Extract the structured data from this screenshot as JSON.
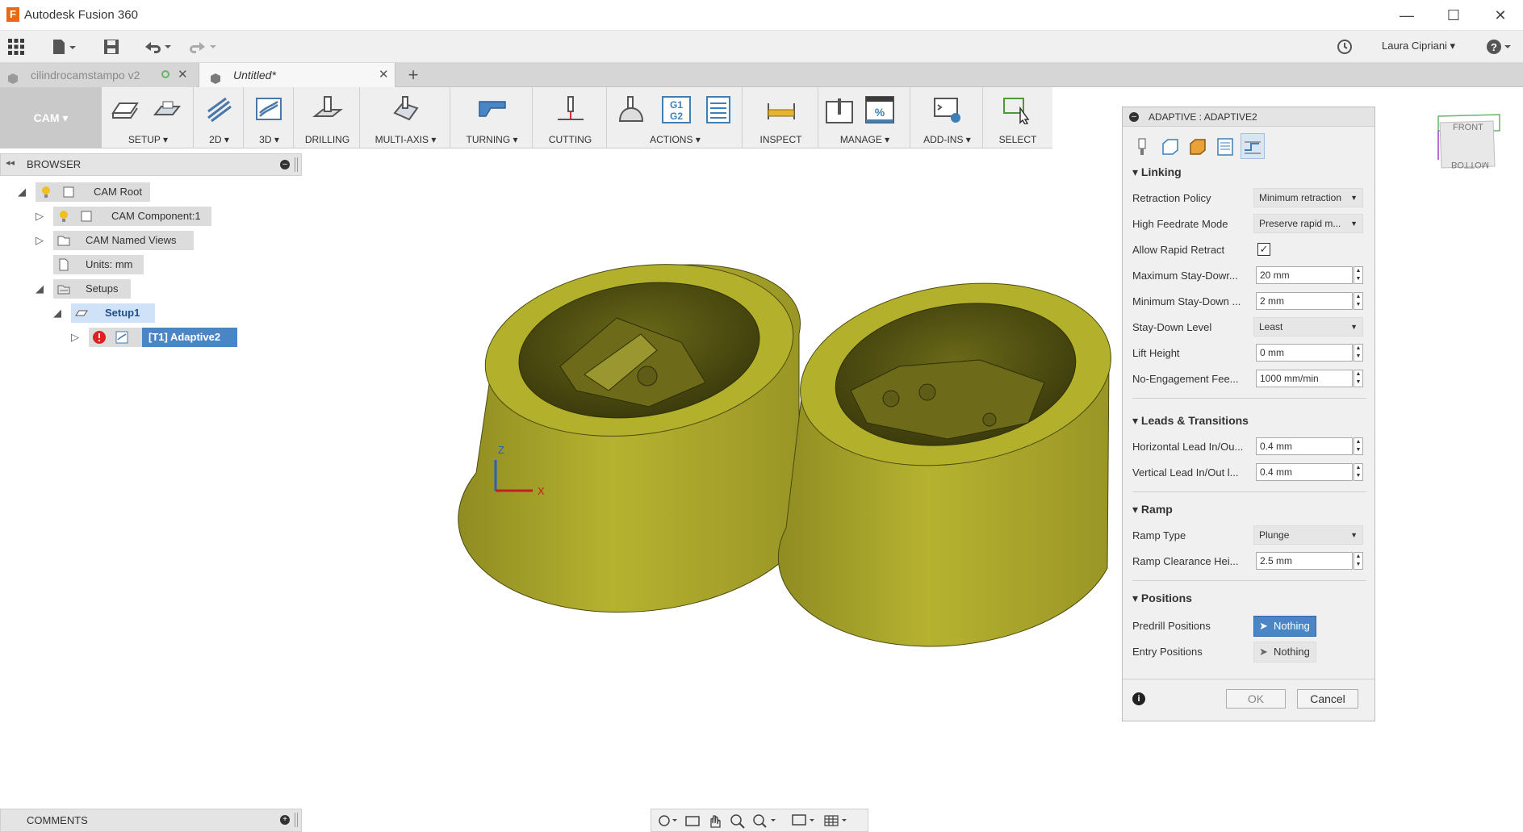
{
  "window": {
    "title": "Autodesk Fusion 360",
    "minimize": "—",
    "maximize": "☐",
    "close": "✕"
  },
  "user": {
    "name": "Laura Cipriani ▾"
  },
  "tabs": [
    {
      "label": "cilindrocamstampo v2",
      "active": false
    },
    {
      "label": "Untitled*",
      "active": true
    }
  ],
  "ribbon": {
    "workspace": "CAM ▾",
    "groups": [
      {
        "label": "SETUP ▾"
      },
      {
        "label": "2D ▾"
      },
      {
        "label": "3D ▾"
      },
      {
        "label": "DRILLING"
      },
      {
        "label": "MULTI-AXIS ▾"
      },
      {
        "label": "TURNING ▾"
      },
      {
        "label": "CUTTING"
      },
      {
        "label": "ACTIONS ▾"
      },
      {
        "label": "INSPECT"
      },
      {
        "label": "MANAGE ▾"
      },
      {
        "label": "ADD-INS ▾"
      },
      {
        "label": "SELECT"
      }
    ],
    "g1g2": "G1G2"
  },
  "browser": {
    "title": "BROWSER",
    "items": [
      {
        "label": "CAM Root"
      },
      {
        "label": "CAM Component:1"
      },
      {
        "label": "CAM Named Views"
      },
      {
        "label": "Units: mm"
      },
      {
        "label": "Setups"
      },
      {
        "label": "Setup1"
      },
      {
        "label": "[T1] Adaptive2"
      }
    ]
  },
  "comments": {
    "title": "COMMENTS"
  },
  "viewcube": {
    "front": "FRONT",
    "bottom": "BOTTOM"
  },
  "triad": {
    "z": "Z",
    "x": "X"
  },
  "dialog": {
    "title": "ADAPTIVE : ADAPTIVE2",
    "sections": {
      "linking": "Linking",
      "leads": "Leads & Transitions",
      "ramp": "Ramp",
      "positions": "Positions"
    },
    "fields": {
      "retraction_policy": {
        "label": "Retraction Policy",
        "value": "Minimum retraction"
      },
      "high_feedrate_mode": {
        "label": "High Feedrate Mode",
        "value": "Preserve rapid m..."
      },
      "allow_rapid_retract": {
        "label": "Allow Rapid Retract",
        "checked": true
      },
      "max_stay_down": {
        "label": "Maximum Stay-Dowr...",
        "value": "20 mm"
      },
      "min_stay_down": {
        "label": "Minimum Stay-Down ...",
        "value": "2 mm"
      },
      "stay_down_level": {
        "label": "Stay-Down Level",
        "value": "Least"
      },
      "lift_height": {
        "label": "Lift Height",
        "value": "0 mm"
      },
      "no_engagement_feed": {
        "label": "No-Engagement Fee...",
        "value": "1000 mm/min"
      },
      "horizontal_lead": {
        "label": "Horizontal Lead In/Ou...",
        "value": "0.4 mm"
      },
      "vertical_lead": {
        "label": "Vertical Lead In/Out l...",
        "value": "0.4 mm"
      },
      "ramp_type": {
        "label": "Ramp Type",
        "value": "Plunge"
      },
      "ramp_clearance": {
        "label": "Ramp Clearance Hei...",
        "value": "2.5 mm"
      },
      "predrill_positions": {
        "label": "Predrill Positions",
        "value": "Nothing"
      },
      "entry_positions": {
        "label": "Entry Positions",
        "value": "Nothing"
      }
    },
    "ok": "OK",
    "cancel": "Cancel"
  },
  "colors": {
    "part": "#b3b02c",
    "accent": "#3f7fb6",
    "selected": "#4a86c6"
  }
}
